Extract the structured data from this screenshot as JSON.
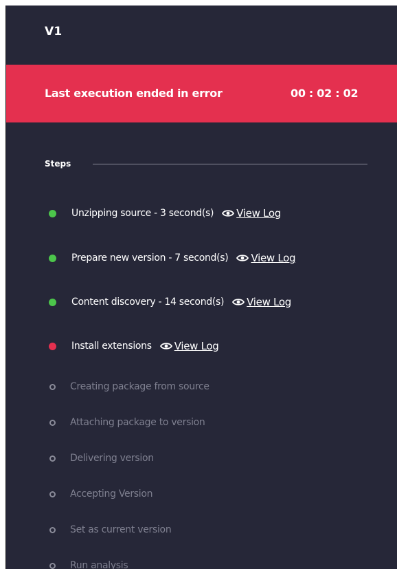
{
  "header": {
    "version": "V1"
  },
  "banner": {
    "message": "Last execution ended in error",
    "timer": "00 : 02 : 02",
    "color": "#e4304f"
  },
  "steps": {
    "label": "Steps",
    "view_log_label": "View Log",
    "items": [
      {
        "label": "Unzipping source - 3 second(s)",
        "status": "success"
      },
      {
        "label": "Prepare new version - 7 second(s)",
        "status": "success"
      },
      {
        "label": "Content discovery - 14 second(s)",
        "status": "success"
      },
      {
        "label": "Install extensions",
        "status": "error"
      },
      {
        "label": "Creating package from source",
        "status": "pending"
      },
      {
        "label": "Attaching package to version",
        "status": "pending"
      },
      {
        "label": "Delivering version",
        "status": "pending"
      },
      {
        "label": "Accepting Version",
        "status": "pending"
      },
      {
        "label": "Set as current version",
        "status": "pending"
      },
      {
        "label": "Run analysis",
        "status": "pending"
      }
    ]
  },
  "colors": {
    "background": "#262738",
    "success": "#4cc54b",
    "error": "#e4304f",
    "pending": "#8a8b99"
  },
  "icons": {
    "view_log": "eye-icon",
    "step_status": "status-dot-icon"
  }
}
